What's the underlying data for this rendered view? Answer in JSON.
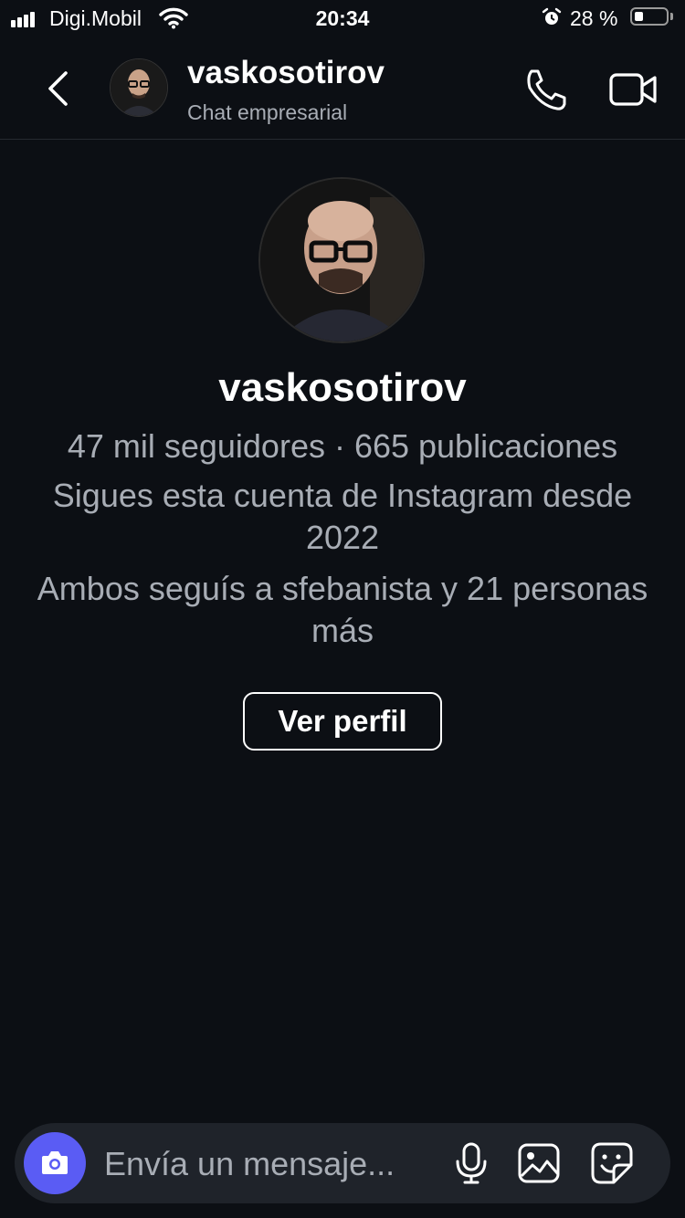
{
  "status_bar": {
    "carrier": "Digi.Mobil",
    "time": "20:34",
    "battery_percent": "28 %",
    "battery_level": 0.28,
    "icons": [
      "signal-icon",
      "wifi-icon",
      "alarm-icon",
      "battery-icon"
    ]
  },
  "header": {
    "name": "vaskosotirov",
    "subtitle": "Chat empresarial",
    "icons": [
      "back-chevron-icon",
      "phone-icon",
      "video-camera-icon"
    ]
  },
  "profile": {
    "name": "vaskosotirov",
    "stats": "47 mil seguidores · 665 publicaciones",
    "follow_since": "Sigues esta cuenta de Instagram desde 2022",
    "mutual": "Ambos seguís a sfebanista y 21 personas más",
    "view_profile_label": "Ver perfil"
  },
  "composer": {
    "placeholder": "Envía un mensaje...",
    "icons": [
      "camera-icon",
      "microphone-icon",
      "gallery-icon",
      "sticker-icon"
    ]
  },
  "colors": {
    "background": "#0c0f14",
    "accent_camera": "#5a5cf4",
    "secondary_text": "#a8adb5",
    "composer_bg": "#1f232a"
  }
}
